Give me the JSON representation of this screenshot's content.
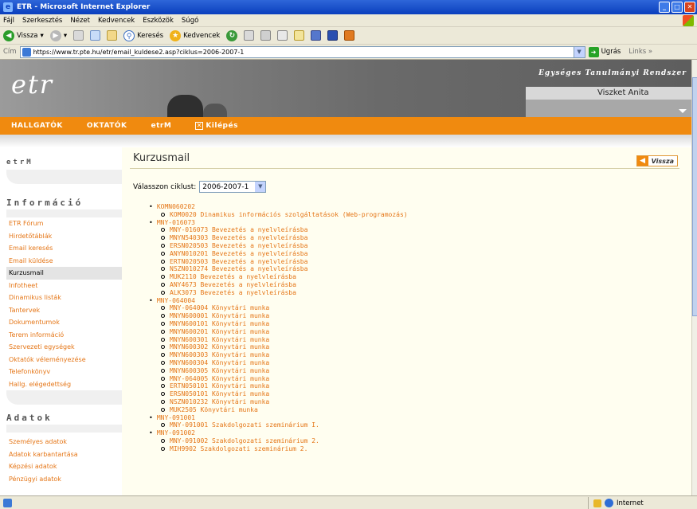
{
  "window": {
    "title": "ETR - Microsoft Internet Explorer"
  },
  "menu": [
    "Fájl",
    "Szerkesztés",
    "Nézet",
    "Kedvencek",
    "Eszközök",
    "Súgó"
  ],
  "toolbar": {
    "back": "Vissza",
    "search": "Keresés",
    "favorites": "Kedvencek"
  },
  "address": {
    "label": "Cím",
    "url": "https://www.tr.pte.hu/etr/email_kuldese2.asp?ciklus=2006-2007-1",
    "go": "Ugrás",
    "links": "Links"
  },
  "header": {
    "logo": "etr",
    "slogan": "Egységes Tanulmányi Rendszer",
    "user": "Viszket Anita"
  },
  "nav": [
    "HALLGATÓK",
    "OKTATÓK",
    "etrM"
  ],
  "nav_logout": "Kilépés",
  "sidebar": {
    "etrm": "etrM",
    "info_title": "Információ",
    "info_links": [
      "ETR Fórum",
      "Hirdetőtáblák",
      "Email keresés",
      "Email küldése",
      "Kurzusmail",
      "Infotheet",
      "Dinamikus listák",
      "Tantervek",
      "Dokumentumok",
      "Terem információ",
      "Szervezeti egységek",
      "Oktatók véleményezése",
      "Telefonkönyv",
      "Hallg. elégedettség"
    ],
    "active_link": "Kurzusmail",
    "data_title": "Adatok",
    "data_links": [
      "Személyes adatok",
      "Adatok karbantartása",
      "Képzési adatok",
      "Pénzügyi adatok"
    ]
  },
  "main": {
    "title": "Kurzusmail",
    "back_label": "Vissza",
    "cycle_label": "Válasszon ciklust:",
    "cycle_value": "2006-2007-1",
    "courses": [
      {
        "code": "KOMN060202",
        "items": [
          "KOM0020 Dinamikus információs szolgáltatások (Web-programozás)"
        ]
      },
      {
        "code": "MNY-016073",
        "items": [
          "MNY-016073 Bevezetés a nyelvleírásba",
          "MNYN540303 Bevezetés a nyelvleírásba",
          "ERSN020503 Bevezetés a nyelvleírásba",
          "ANYN010201 Bevezetés a nyelvleírásba",
          "ERTN020503 Bevezetés a nyelvleírásba",
          "NSZN010274 Bevezetés a nyelvleírásba",
          "MUK2110 Bevezetés a nyelvleírásba",
          "ANY4673 Bevezetés a nyelvleírásba",
          "ALK3073 Bevezetés a nyelvleírásba"
        ]
      },
      {
        "code": "MNY-064004",
        "items": [
          "MNY-064004 Könyvtári munka",
          "MNYN600001 Könyvtári munka",
          "MNYN600101 Könyvtári munka",
          "MNYN600201 Könyvtári munka",
          "MNYN600301 Könyvtári munka",
          "MNYN600302 Könyvtári munka",
          "MNYN600303 Könyvtári munka",
          "MNYN600304 Könyvtári munka",
          "MNYN600305 Könyvtári munka",
          "MNY-064005 Könyvtári munka",
          "ERTN050101 Könyvtári munka",
          "ERSN050101 Könyvtári munka",
          "NSZN010232 Könyvtári munka",
          "MUK2505 Könyvtári munka"
        ]
      },
      {
        "code": "MNY-091001",
        "items": [
          "MNY-091001 Szakdolgozati szeminárium I."
        ]
      },
      {
        "code": "MNY-091002",
        "items": [
          "MNY-091002 Szakdolgozati szeminárium 2.",
          "MIH9902 Szakdolgozati szeminárium 2."
        ]
      }
    ]
  },
  "status": {
    "zone": "Internet"
  }
}
